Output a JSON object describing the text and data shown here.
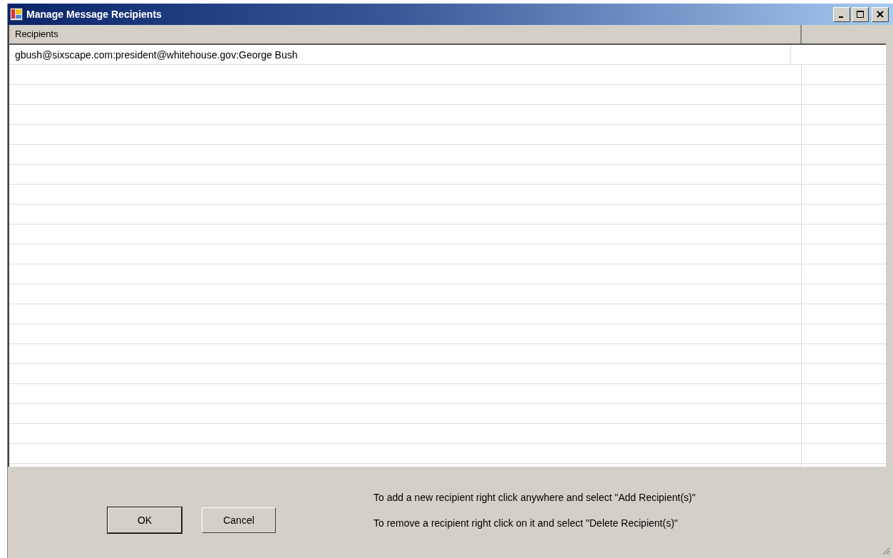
{
  "window": {
    "title": "Manage Message Recipients"
  },
  "table": {
    "columns": [
      "Recipients"
    ],
    "rows": [
      {
        "cells": [
          "gbush@sixscape.com:president@whitehouse.gov:George Bush"
        ]
      }
    ]
  },
  "buttons": [
    {
      "label": "OK",
      "default": true
    },
    {
      "label": "Cancel",
      "default": false
    }
  ],
  "help_lines": [
    "To add a new recipient right click anywhere and select \"Add Recipient(s)\"",
    "To remove a recipient right click on it and select \"Delete Recipient(s)\""
  ]
}
